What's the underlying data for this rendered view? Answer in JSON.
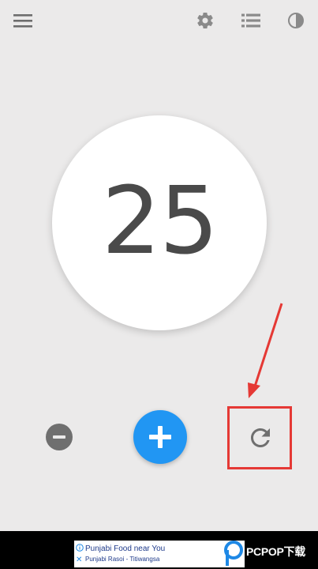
{
  "header": {
    "icons": [
      "menu-icon",
      "gear-icon",
      "list-icon",
      "contrast-icon"
    ]
  },
  "counter": {
    "value": "25"
  },
  "controls": {
    "icons": [
      "minus-icon",
      "plus-icon",
      "reset-icon"
    ],
    "accent_color": "#2196f3",
    "highlight_color": "#e53935"
  },
  "ad": {
    "title": "Punjabi Food near You",
    "subtitle": "Punjabi Rasoi - Titiwangsa"
  },
  "watermark": {
    "text": "PCPOP下载"
  }
}
